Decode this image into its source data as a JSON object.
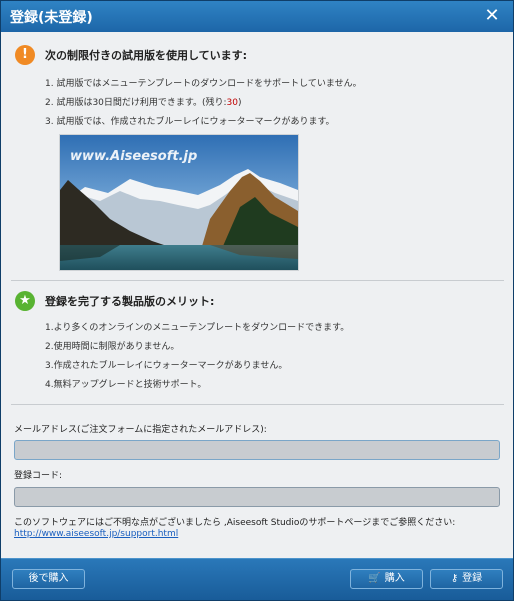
{
  "window": {
    "title": "登録(未登録)",
    "close_icon": "close-icon"
  },
  "trial": {
    "heading": "次の制限付きの試用版を使用しています:",
    "items": [
      {
        "text": "1. 試用版ではメニューテンプレートのダウンロードをサポートしていません。"
      },
      {
        "text_before": "2. 試用版は30日間だけ利用できます。(残り:",
        "remaining": "30",
        "text_after": ")"
      },
      {
        "text": "3. 試用版では、作成されたブルーレイにウォーターマークがあります。"
      }
    ],
    "preview_watermark": "www.Aiseesoft.jp"
  },
  "benefits": {
    "heading": "登録を完了する製品版のメリット:",
    "items": [
      "1.より多くのオンラインのメニューテンプレートをダウンロードできます。",
      "2.使用時間に制限がありません。",
      "3.作成されたブルーレイにウォーターマークがありません。",
      "4.無料アップグレードと技術サポート。"
    ]
  },
  "form": {
    "email_label": "メールアドレス(ご注文フォームに指定されたメールアドレス):",
    "email_value": "",
    "code_label": "登録コード:",
    "code_value": ""
  },
  "support": {
    "note": "このソフトウェアにはご不明な点がございましたら ,Aiseesoft Studioのサポートページまでご参照ください:",
    "link": "http://www.aiseesoft.jp/support.html"
  },
  "buttons": {
    "later": "後で購入",
    "buy": "購入",
    "register": "登録"
  },
  "colors": {
    "titlebar": "#1d66a8",
    "warning_badge": "#f08a24",
    "star_badge": "#58b332",
    "remaining_days": "#c00000",
    "link": "#1a5fbf"
  }
}
